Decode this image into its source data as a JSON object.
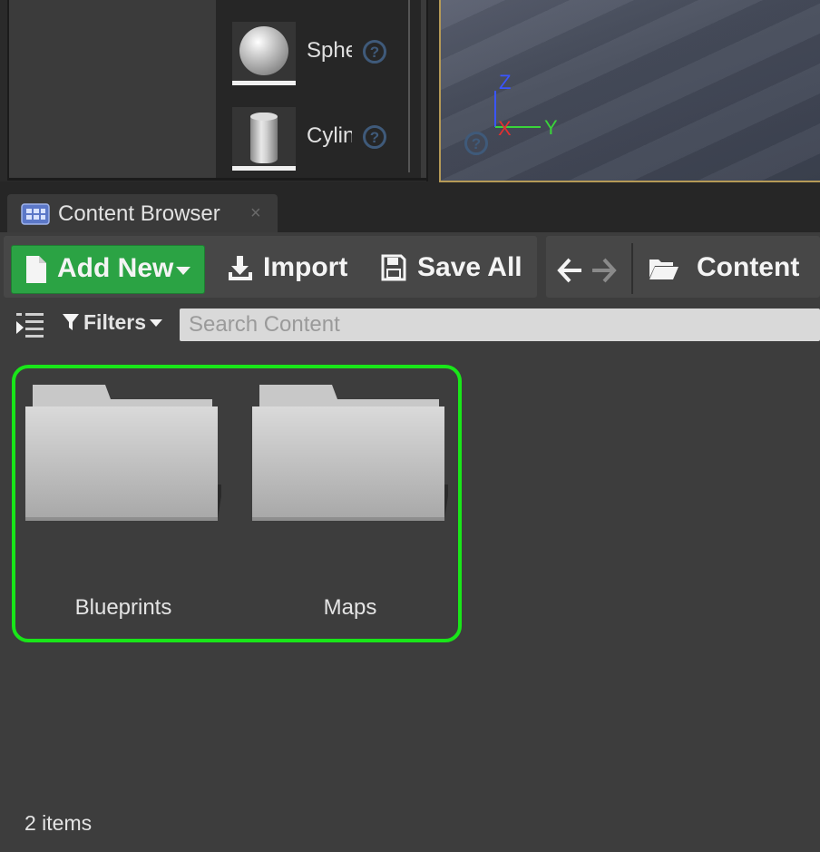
{
  "place_actors": {
    "items": [
      {
        "label": "Sphere",
        "icon": "sphere-thumbnail"
      },
      {
        "label": "Cylinder",
        "icon": "cylinder-thumbnail"
      }
    ],
    "help_glyph": "?"
  },
  "viewport": {
    "axes": {
      "z": "Z",
      "x": "X",
      "y": "Y"
    },
    "colors": {
      "z": "#3a55ff",
      "x": "#e23030",
      "y": "#3ad43a"
    }
  },
  "tab": {
    "label": "Content Browser",
    "close_glyph": "×",
    "icon": "content-browser-icon"
  },
  "toolbar": {
    "add_new": "Add New",
    "import": "Import",
    "save_all": "Save All",
    "path": "Content",
    "accent": "#2ba344"
  },
  "filter_bar": {
    "filters_label": "Filters",
    "search_placeholder": "Search Content"
  },
  "assets": [
    {
      "name": "Blueprints",
      "type": "folder"
    },
    {
      "name": "Maps",
      "type": "folder"
    }
  ],
  "selection_color": "#19e619",
  "status": {
    "item_count": "2 items"
  }
}
